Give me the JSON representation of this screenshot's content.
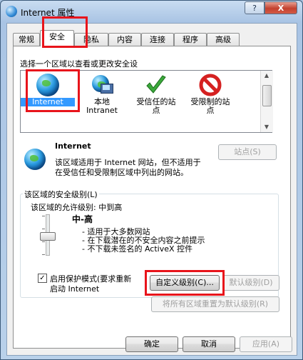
{
  "window": {
    "title": "Internet 属性",
    "help_label": "?",
    "close_label": "X"
  },
  "tabs": [
    {
      "label": "常规"
    },
    {
      "label": "安全"
    },
    {
      "label": "隐私"
    },
    {
      "label": "内容"
    },
    {
      "label": "连接"
    },
    {
      "label": "程序"
    },
    {
      "label": "高级"
    }
  ],
  "active_tab": "安全",
  "zones_section": {
    "prompt": "选择一个区域以查看或更改安全设",
    "zones": [
      {
        "line1": "Internet",
        "line2": "",
        "icon": "globe-icon",
        "selected": true
      },
      {
        "line1": "本地",
        "line2": "Intranet",
        "icon": "local-intranet-icon",
        "selected": false
      },
      {
        "line1": "受信任的站",
        "line2": "点",
        "icon": "check-icon",
        "selected": false
      },
      {
        "line1": "受限制的站",
        "line2": "点",
        "icon": "no-entry-icon",
        "selected": false
      }
    ]
  },
  "zone_info": {
    "name": "Internet",
    "desc_line1": "该区域适用于 Internet 网站，但不适用于",
    "desc_line2": "在受信任和受限制区域中列出的网站。",
    "sites_button": "站点(S)"
  },
  "security_level": {
    "group_title": "该区域的安全级别(L)",
    "allowed_levels": "该区域的允许级别: 中到高",
    "level_name": "中-高",
    "bullets": [
      "- 适用于大多数网站",
      "- 在下载潜在的不安全内容之前提示",
      "- 不下载未签名的 ActiveX 控件"
    ],
    "protected_mode_line1": "启用保护模式(要求重新",
    "protected_mode_line2": "启动 Internet",
    "protected_mode_checked": true,
    "checkbox_mark": "✓",
    "custom_level_button": "自定义级别(C)...",
    "default_level_button": "默认级别(D)",
    "reset_all_button": "将所有区域重置为默认级别(R)"
  },
  "footer": {
    "ok": "确定",
    "cancel": "取消",
    "apply": "应用(A)"
  },
  "colors": {
    "highlight": "#e8141b",
    "selection": "#3399ff"
  }
}
